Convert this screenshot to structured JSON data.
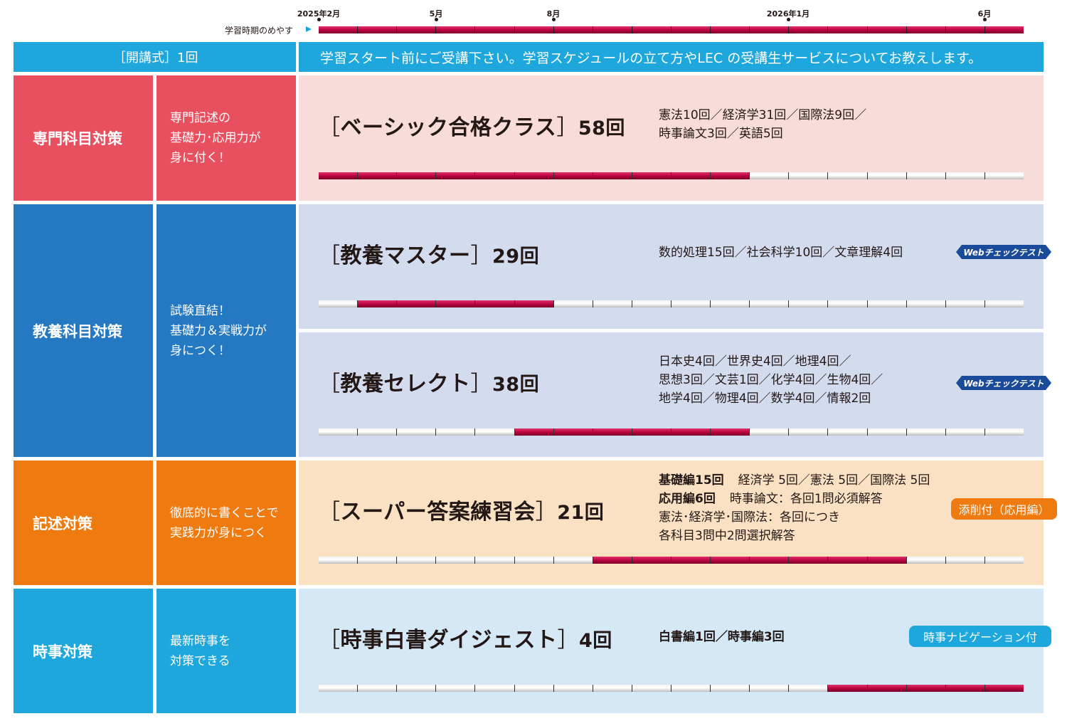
{
  "timeline": {
    "guide_label": "学習時期のめやす",
    "ticks": [
      "2025年2月",
      "5月",
      "8月",
      "2026年1月",
      "6月"
    ]
  },
  "intro": {
    "label": "［開講式］1回",
    "text": "学習スタート前にご受講下さい。学習スケジュールの立て方やLEC の受講生サービスについてお教えします。"
  },
  "sections": {
    "senmon": {
      "category": "専門科目対策",
      "desc_lines": [
        "専門記述の",
        "基礎力･応用力が",
        "身に付く！"
      ]
    },
    "kyoyo": {
      "category": "教養科目対策",
      "desc_lines": [
        "試験直結！",
        "基礎力＆実戦力が",
        "身につく！"
      ]
    },
    "kijutsu": {
      "category": "記述対策",
      "desc_lines": [
        "徹底的に書くことで",
        "実践力が身につく"
      ]
    },
    "jiji": {
      "category": "時事対策",
      "desc_lines": [
        "最新時事を",
        "対策できる"
      ]
    }
  },
  "courses": {
    "basic": {
      "open": "［",
      "name": "ベーシック合格クラス",
      "close": "］",
      "count": "58回",
      "detail_lines": [
        "憲法10回／経済学31回／国際法9回／",
        "時事論文3回／英語5回"
      ]
    },
    "kyoyo_master": {
      "open": "［",
      "name": "教養マスター",
      "close": "］",
      "count": "29回",
      "detail_lines": [
        "数的処理15回／社会科学10回／文章理解4回"
      ],
      "badge": "Webチェックテスト"
    },
    "kyoyo_select": {
      "open": "［",
      "name": "教養セレクト",
      "close": "］",
      "count": "38回",
      "detail_lines": [
        "日本史4回／世界史4回／地理4回／",
        "思想3回／文芸1回／化学4回／生物4回／",
        "地学4回／物理4回／数学4回／情報2回"
      ],
      "badge": "Webチェックテスト"
    },
    "super": {
      "open": "［",
      "name": "スーパー答案練習会",
      "close": "］",
      "count": "21回",
      "kiso_label": "基礎編15回",
      "kiso_text": "経済学 5回／憲法 5回／国際法 5回",
      "ouyou_label": "応用編6回",
      "ouyou_text": "時事論文：各回1問必須解答",
      "detail_lines": [
        "憲法･経済学･国際法：各回につき",
        "各科目3問中2問選択解答"
      ],
      "badge": "添削付（応用編）"
    },
    "jiji_hakusho": {
      "open": "［",
      "name": "時事白書ダイジェスト",
      "close": "］",
      "count": "4回",
      "detail_lines": [
        "白書編1回／時事編3回"
      ],
      "badge": "時事ナビゲーション付"
    }
  },
  "colors": {
    "red": "#e8505f",
    "red_light": "#f8dcd9",
    "blue": "#2479c2",
    "blue_light": "#d3dbee",
    "orange": "#ee7a10",
    "orange_light": "#fbe1c4",
    "cyan": "#1ea7dc",
    "cyan_light": "#d4e8f6",
    "bar_active": "#c3094a",
    "badge_navy": "#1a4b9a"
  },
  "chart_data": {
    "type": "gantt",
    "periods": [
      "2025年2月",
      "2025年3月",
      "2025年4月",
      "2025年5月",
      "2025年6月",
      "2025年7月",
      "2025年8月",
      "2025年9月",
      "2025年10月",
      "2025年11月",
      "2025年12月",
      "2026年1月",
      "2026年2月",
      "2026年3月",
      "2026年4月",
      "2026年5月",
      "2026年6月",
      "2026年7月"
    ],
    "series": [
      {
        "name": "学習時期のめやす",
        "start": "2025年2月",
        "end": "2026年7月"
      },
      {
        "name": "ベーシック合格クラス",
        "start": "2025年2月",
        "end": "2025年12月"
      },
      {
        "name": "教養マスター",
        "start": "2025年3月",
        "end": "2025年7月"
      },
      {
        "name": "教養セレクト",
        "start": "2025年7月",
        "end": "2025年12月"
      },
      {
        "name": "スーパー答案練習会",
        "start": "2025年9月",
        "end": "2026年4月"
      },
      {
        "name": "時事白書ダイジェスト",
        "start": "2026年3月",
        "end": "2026年7月"
      }
    ]
  }
}
